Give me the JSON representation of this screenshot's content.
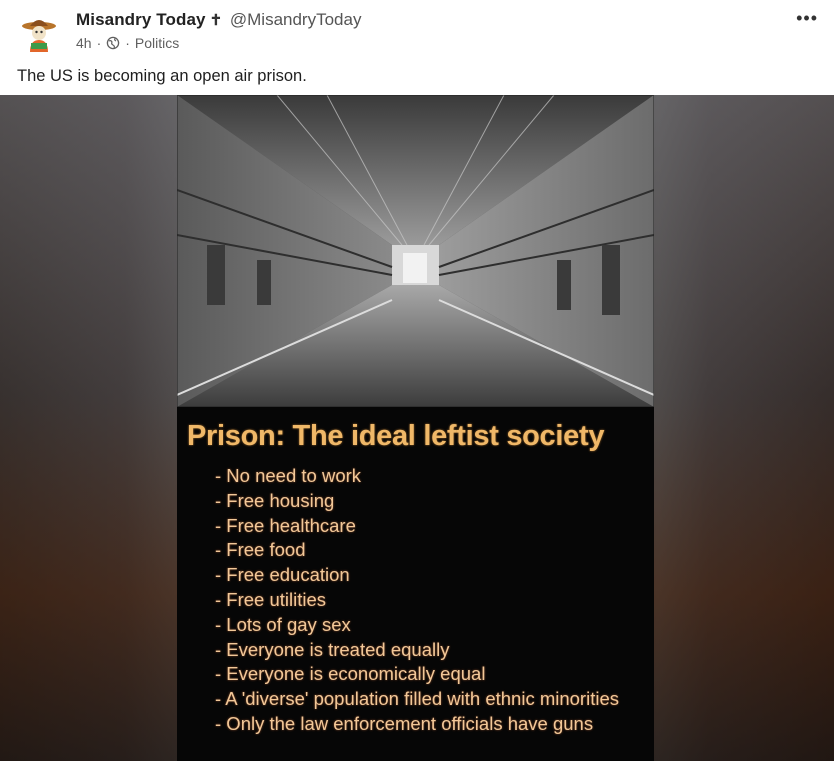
{
  "post": {
    "author_name": "Misandry Today",
    "verified_glyph": "✝",
    "handle": "@MisandryToday",
    "time": "4h",
    "separator": "·",
    "visibility_icon": "globe-icon",
    "category": "Politics",
    "more_icon": "more-options-icon",
    "more_glyph": "•••",
    "text": "The US is becoming an open air prison."
  },
  "meme": {
    "title": "Prison: The ideal leftist society",
    "items": [
      "- No need to work",
      "- Free housing",
      "- Free healthcare",
      "- Free food",
      "- Free education",
      "- Free utilities",
      "- Lots of gay sex",
      "- Everyone is treated equally",
      "- Everyone is economically equal",
      "- A 'diverse' population filled with ethnic minorities",
      "- Only the law enforcement officials have guns"
    ]
  },
  "colors": {
    "meme_text": "#f0b868",
    "meme_background": "#060606"
  }
}
